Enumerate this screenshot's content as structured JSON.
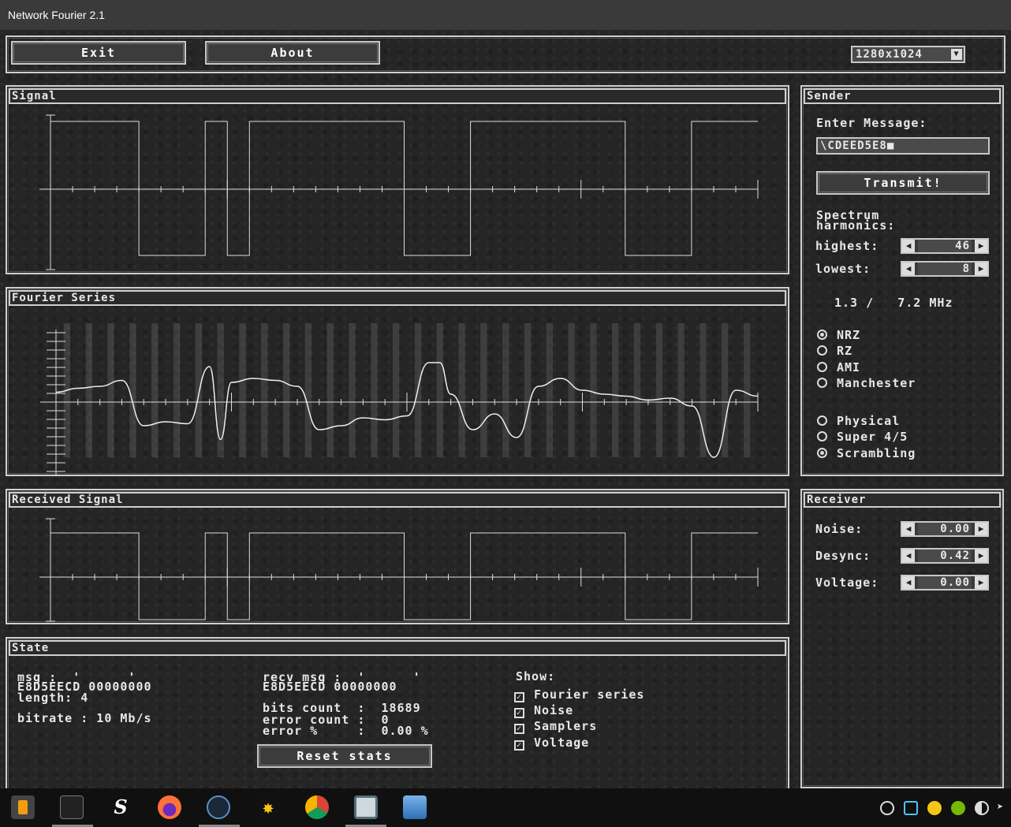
{
  "window": {
    "title": "Network Fourier 2.1"
  },
  "toolbar": {
    "exit_label": "Exit",
    "about_label": "About",
    "resolution": "1280x1024"
  },
  "panels": {
    "signal": "Signal",
    "fourier": "Fourier Series",
    "received": "Received Signal",
    "state": "State",
    "sender": "Sender",
    "receiver": "Receiver"
  },
  "sender": {
    "enter_message_label": "Enter Message:",
    "message_value": "\\CDEED5E8",
    "transmit_label": "Transmit!",
    "spectrum_label": "Spectrum harmonics:",
    "highest_label": "highest:",
    "highest_value": "46",
    "lowest_label": "lowest:",
    "lowest_value": "8",
    "bandwidth": "1.3 /   7.2 MHz",
    "encodings": [
      {
        "label": "NRZ",
        "selected": true
      },
      {
        "label": "RZ",
        "selected": false
      },
      {
        "label": "AMI",
        "selected": false
      },
      {
        "label": "Manchester",
        "selected": false
      }
    ],
    "layers": [
      {
        "label": "Physical",
        "selected": false
      },
      {
        "label": "Super 4/5",
        "selected": false
      },
      {
        "label": "Scrambling",
        "selected": true
      }
    ]
  },
  "receiver": {
    "noise_label": "Noise:",
    "noise_value": "0.00",
    "desync_label": "Desync:",
    "desync_value": "0.42",
    "voltage_label": "Voltage:",
    "voltage_value": "0.00"
  },
  "state": {
    "msg_line1": "msg :  '      '",
    "msg_line2": "E8D5EECD 00000000",
    "length": "length: 4",
    "bitrate": "bitrate : 10 Mb/s",
    "recv_line1": "recv msg :  '      '",
    "recv_line2": "E8D5EECD 00000000",
    "bits_count": "bits count  :  18689",
    "error_count": "error count :  0",
    "error_pct": "error %     :  0.00 %",
    "reset_label": "Reset stats",
    "show_label": "Show:",
    "show_options": [
      {
        "label": "Fourier series",
        "checked": true
      },
      {
        "label": "Noise",
        "checked": true
      },
      {
        "label": "Samplers",
        "checked": true
      },
      {
        "label": "Voltage",
        "checked": true
      }
    ]
  },
  "chart_data": {
    "type": "line",
    "signal_levels": [
      1,
      1,
      1,
      1,
      0,
      0,
      0,
      1,
      0,
      1,
      1,
      1,
      1,
      1,
      1,
      1,
      0,
      0,
      0,
      1,
      1,
      1,
      1,
      1,
      1,
      1,
      0,
      0,
      0,
      1,
      1,
      1
    ],
    "fourier_points": [
      [
        0,
        0.25
      ],
      [
        1,
        0.35
      ],
      [
        2,
        0.4
      ],
      [
        3,
        0.55
      ],
      [
        4,
        -0.6
      ],
      [
        5,
        -0.5
      ],
      [
        6,
        -0.55
      ],
      [
        7,
        0.9
      ],
      [
        7.5,
        -0.95
      ],
      [
        8,
        0.5
      ],
      [
        9,
        0.6
      ],
      [
        10,
        0.55
      ],
      [
        11,
        0.4
      ],
      [
        12,
        -0.7
      ],
      [
        13,
        -0.6
      ],
      [
        14,
        -0.4
      ],
      [
        15,
        -0.45
      ],
      [
        16,
        -0.35
      ],
      [
        17,
        1.0
      ],
      [
        17.5,
        1.0
      ],
      [
        18,
        0.2
      ],
      [
        19,
        -0.7
      ],
      [
        20,
        -0.3
      ],
      [
        21,
        -0.9
      ],
      [
        22,
        0.4
      ],
      [
        23,
        0.6
      ],
      [
        24,
        0.3
      ],
      [
        25,
        0.2
      ],
      [
        26,
        0.15
      ],
      [
        27,
        0.05
      ],
      [
        28,
        0.1
      ],
      [
        29,
        -0.1
      ],
      [
        30,
        -1.4
      ],
      [
        31,
        0.3
      ],
      [
        32,
        0.15
      ]
    ],
    "received_levels": [
      1,
      1,
      1,
      1,
      0,
      0,
      0,
      1,
      0,
      1,
      1,
      1,
      1,
      1,
      1,
      1,
      0,
      0,
      0,
      1,
      1,
      1,
      1,
      1,
      1,
      1,
      0,
      0,
      0,
      1,
      1,
      1
    ]
  },
  "taskbar": {
    "icons": [
      "sublime-icon",
      "terminal-icon",
      "s-app-icon",
      "firefox-icon",
      "steam-icon",
      "spark-icon",
      "chrome-icon",
      "window-app-icon",
      "photos-icon"
    ]
  }
}
